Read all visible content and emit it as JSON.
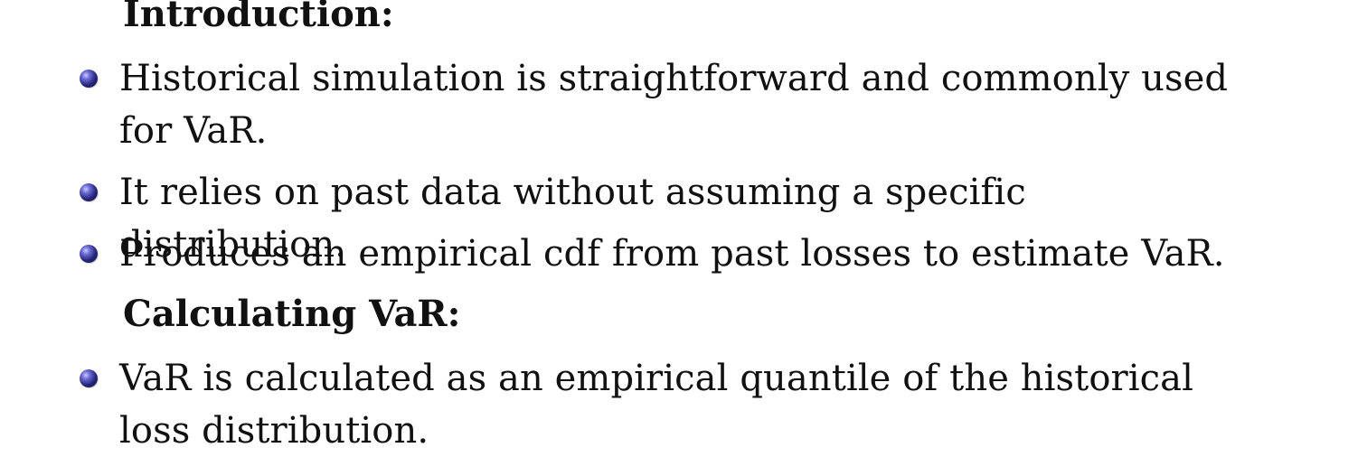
{
  "sections": [
    {
      "heading": "Introduction:",
      "bullets": [
        "Historical simulation is straightforward and commonly used for VaR.",
        "It relies on past data without assuming a specific distribution.",
        "Produces an empirical cdf from past losses to estimate VaR."
      ]
    },
    {
      "heading": "Calculating VaR:",
      "bullets": [
        "VaR is calculated as an empirical quantile of the historical loss distribution."
      ]
    }
  ]
}
